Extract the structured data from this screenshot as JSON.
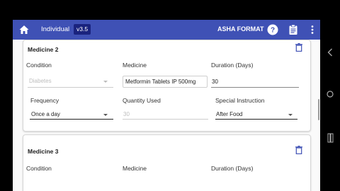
{
  "app": {
    "title": "Individual",
    "version": "v3.5",
    "format_label": "ASHA FORMAT",
    "home_icon": "home-icon",
    "help_icon": "help-circle-icon",
    "clipboard_icon": "clipboard-icon",
    "menu_icon": "more-vert-icon"
  },
  "colors": {
    "appbar": "#3f51b5",
    "version_badge": "#1a237e",
    "delete_icon": "#3f51b5"
  },
  "medicine2": {
    "heading": "Medicine 2",
    "condition_label": "Condition",
    "condition_value": "Diabetes",
    "medicine_label": "Medicine",
    "medicine_value": "Metformin Tablets IP 500mg",
    "duration_label": "Duration (Days)",
    "duration_value": "30",
    "frequency_label": "Frequency",
    "frequency_value": "Once a day",
    "quantity_label": "Quantity Used",
    "quantity_value": "30",
    "instruction_label": "Special Instruction",
    "instruction_value": "After Food"
  },
  "medicine3": {
    "heading": "Medicine 3",
    "condition_label": "Condition",
    "medicine_label": "Medicine",
    "duration_label": "Duration (Days)"
  },
  "system_nav": {
    "back_icon": "chevron-left-icon",
    "home_icon": "circle-home-icon",
    "recents_icon": "recents-icon"
  }
}
